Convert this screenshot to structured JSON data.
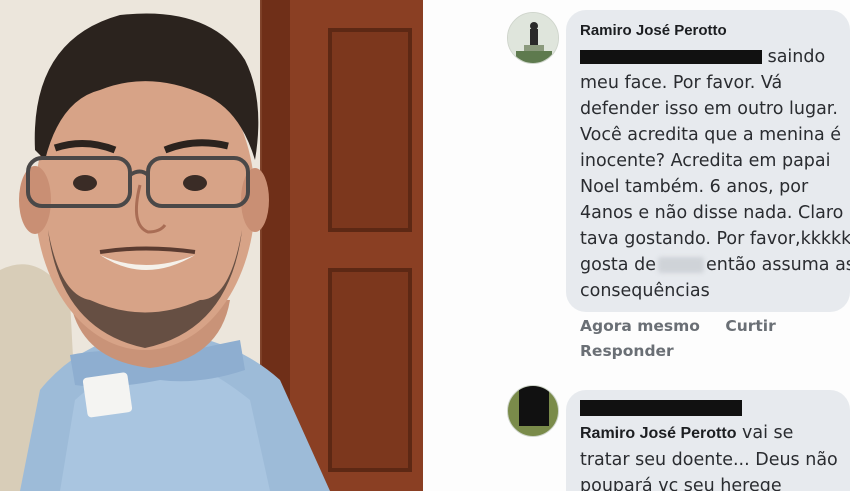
{
  "comment1": {
    "author": "Ramiro José Perotto",
    "lines": [
      "saindo",
      "meu face. Por favor. Vá",
      "defender isso em outro lugar.",
      "Você acredita que a menina é",
      "inocente? Acredita em papai",
      "Noel também. 6 anos, por",
      "4anos e não disse nada. Claro",
      "tava gostando. Por favor,kkkkk",
      "gosta de",
      "então assuma as",
      "consequências"
    ],
    "time": "Agora mesmo",
    "like": "Curtir",
    "reply": "Responder"
  },
  "comment2": {
    "mention": "Ramiro José Perotto",
    "line1_rest": " vai se",
    "line2": "tratar seu doente... Deus não",
    "line3": "poupará vc seu herege"
  },
  "colors": {
    "bubble": "#e7eaee",
    "action_text": "#6a6f75",
    "redaction": "#111111"
  }
}
